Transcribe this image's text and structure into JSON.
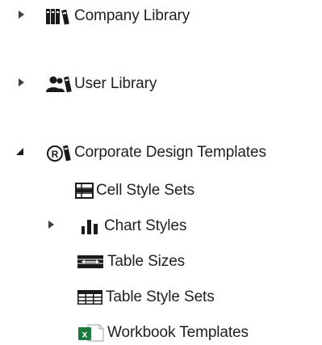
{
  "tree": {
    "company_library": {
      "label": "Company Library",
      "icon": "library-books-icon",
      "expanded": false
    },
    "user_library": {
      "label": "User Library",
      "icon": "user-library-icon",
      "expanded": false
    },
    "corporate_design_templates": {
      "label": "Corporate Design Templates",
      "icon": "registered-books-icon",
      "expanded": true,
      "children": [
        {
          "label": "Cell Style Sets",
          "icon": "cell-style-icon"
        },
        {
          "label": "Chart Styles",
          "icon": "bar-chart-icon",
          "expanded": false
        },
        {
          "label": "Table Sizes",
          "icon": "table-size-icon"
        },
        {
          "label": "Table Style Sets",
          "icon": "table-grid-icon"
        },
        {
          "label": "Workbook Templates",
          "icon": "excel-workbook-icon"
        }
      ]
    }
  },
  "colors": {
    "arrow": "#404040",
    "icon_dark": "#1a1a1a",
    "excel_green": "#1d7a3e",
    "text": "#1f1f1f"
  }
}
